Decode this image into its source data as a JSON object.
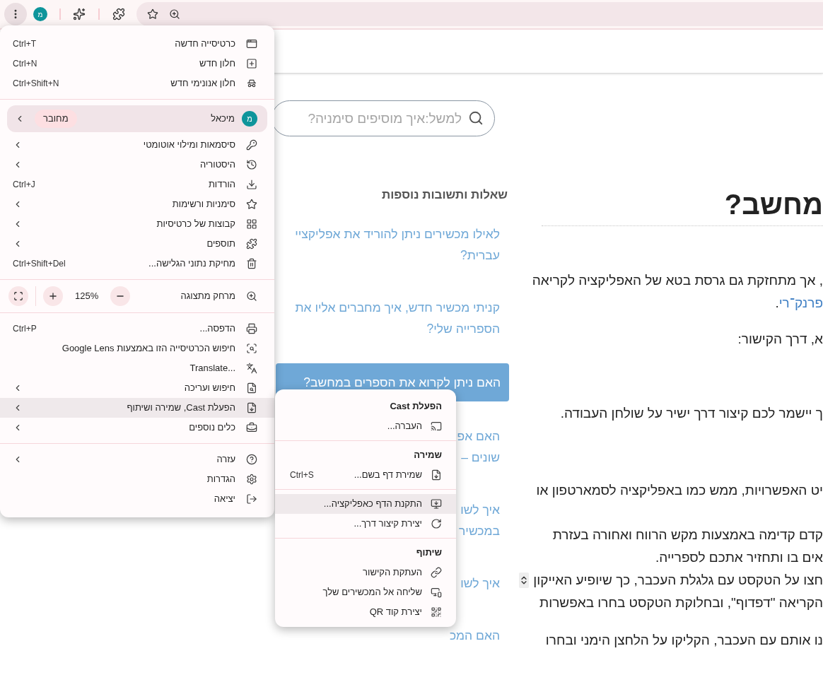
{
  "toolbar": {
    "avatar": "מ"
  },
  "page": {
    "search": {
      "placeholder": "למשל:איך מוסיפים סימניה?"
    },
    "sidebar": {
      "heading": "שאלות ותשובות נוספות",
      "items": [
        {
          "lines": [
            "לאילו מכשירים ניתן להוריד את אפליקציי",
            "עברית?"
          ],
          "selected": false
        },
        {
          "lines": [
            "קניתי מכשיר חדש, איך מחברים אליו את",
            "הספרייה שלי?"
          ],
          "selected": false
        },
        {
          "lines": [
            "האם ניתן לקרוא את הספרים במחשב?"
          ],
          "selected": true
        },
        {
          "lines": [
            "האם אפ",
            "שונים –"
          ],
          "selected": false
        },
        {
          "lines": [
            "איך לשו",
            "במכשיר"
          ],
          "selected": false
        },
        {
          "lines": [
            "איך לשו"
          ],
          "selected": false
        },
        {
          "lines": [
            "האם המכ"
          ],
          "selected": false
        }
      ]
    },
    "article": {
      "title": "מחשב?",
      "paragraphs": [
        {
          "lines": [
            [
              {
                "kind": "text",
                "text": ", אך מתחזקת גם גרסת בטא של האפליקציה לקריאה"
              }
            ],
            [
              {
                "kind": "link",
                "text": "פרנק־רי"
              },
              {
                "kind": "text",
                "text": "."
              }
            ]
          ]
        },
        {
          "lines": [
            [
              {
                "kind": "text",
                "text": "א, דרך הקישור:"
              }
            ]
          ]
        },
        {
          "lines": [
            [
              {
                "kind": "text",
                "text": "ך יישמר לכם קיצור דרך ישיר על שולחן העבודה."
              }
            ]
          ]
        },
        {
          "lines": [
            [
              {
                "kind": "text",
                "text": "יט האפשרויות, ממש כמו באפליקציה לסמארטפון או"
              }
            ]
          ]
        },
        {
          "lines": [
            [
              {
                "kind": "text",
                "text": "קדם קדימה באמצעות מקש הרווח ואחורה בעזרת"
              }
            ],
            [
              {
                "kind": "text",
                "text": "אים בו ותחזיר אתכם לספרייה."
              }
            ],
            [
              {
                "kind": "text",
                "text": "חצו על הטקסט עם גלגלת העכבר, כך שיופיע האייקון"
              },
              {
                "kind": "icon"
              }
            ],
            [
              {
                "kind": "text",
                "text": "הקריאה \"דפדוף\", ובחלוקת הטקסט בחרו באפשרות"
              }
            ]
          ]
        },
        {
          "lines": [
            [
              {
                "kind": "text",
                "text": "נו אותם עם העכבר, הקליקו על הלחצן הימני ובחרו"
              }
            ]
          ]
        }
      ]
    }
  },
  "menu": {
    "sections": [
      {
        "items": [
          {
            "kind": "item",
            "label": "כרטיסייה חדשה",
            "shortcut": "Ctrl+T",
            "submenu": false,
            "highlighted": false
          },
          {
            "kind": "item",
            "label": "חלון חדש",
            "shortcut": "Ctrl+N",
            "submenu": false,
            "highlighted": false
          },
          {
            "kind": "item",
            "label": "חלון אנונימי חדש",
            "shortcut": "Ctrl+Shift+N",
            "submenu": false,
            "highlighted": false
          }
        ]
      },
      {
        "items": [
          {
            "kind": "profile",
            "avatar": "מ",
            "label": "מיכאל",
            "badge": "מחובר",
            "submenu": true
          },
          {
            "kind": "item",
            "label": "סיסמאות ומילוי אוטומטי",
            "submenu": true,
            "highlighted": false
          },
          {
            "kind": "item",
            "label": "היסטוריה",
            "submenu": true,
            "highlighted": false
          },
          {
            "kind": "item",
            "label": "הורדות",
            "shortcut": "Ctrl+J",
            "submenu": false,
            "highlighted": false
          },
          {
            "kind": "item",
            "label": "סימניות ורשימות",
            "submenu": true,
            "highlighted": false
          },
          {
            "kind": "item",
            "label": "קבוצות של כרטיסיות",
            "submenu": true,
            "highlighted": false
          },
          {
            "kind": "item",
            "label": "תוספים",
            "submenu": true,
            "highlighted": false
          },
          {
            "kind": "item",
            "label": "מחיקת נתוני הגלישה...",
            "shortcut": "Ctrl+Shift+Del",
            "submenu": false,
            "highlighted": false
          }
        ]
      },
      {
        "items": [
          {
            "kind": "zoom",
            "label": "מרחק מתצוגה",
            "value": "125%"
          }
        ]
      },
      {
        "items": [
          {
            "kind": "item",
            "label": "הדפסה...",
            "shortcut": "Ctrl+P",
            "submenu": false,
            "highlighted": false
          },
          {
            "kind": "item",
            "label": "חיפוש הכרטיסייה הזו באמצעות Google Lens",
            "submenu": false,
            "highlighted": false
          },
          {
            "kind": "item",
            "label": "Translate...",
            "submenu": false,
            "highlighted": false
          },
          {
            "kind": "item",
            "label": "חיפוש ועריכה",
            "submenu": true,
            "highlighted": false
          },
          {
            "kind": "item",
            "label": "הפעלת Cast, שמירה ושיתוף",
            "submenu": true,
            "highlighted": true
          },
          {
            "kind": "item",
            "label": "כלים נוספים",
            "submenu": true,
            "highlighted": false
          }
        ]
      },
      {
        "items": [
          {
            "kind": "item",
            "label": "עזרה",
            "submenu": true,
            "highlighted": false
          },
          {
            "kind": "item",
            "label": "הגדרות",
            "submenu": false,
            "highlighted": false
          },
          {
            "kind": "item",
            "label": "יציאה",
            "submenu": false,
            "highlighted": false
          }
        ]
      }
    ]
  },
  "submenu": {
    "sections": [
      {
        "heading": "הפעלת Cast",
        "items": [
          {
            "label": "העברה...",
            "highlighted": false
          }
        ]
      },
      {
        "heading": "שמירה",
        "items": [
          {
            "label": "שמירת דף בשם...",
            "shortcut": "Ctrl+S",
            "highlighted": false
          }
        ]
      },
      {
        "items": [
          {
            "label": "התקנת הדף כאפליקציה...",
            "highlighted": true
          },
          {
            "label": "יצירת קיצור דרך...",
            "highlighted": false
          }
        ]
      },
      {
        "heading": "שיתוף",
        "items": [
          {
            "label": "העתקת הקישור",
            "highlighted": false
          },
          {
            "label": "שליחה אל המכשירים שלך",
            "highlighted": false
          },
          {
            "label": "יצירת קוד QR",
            "highlighted": false
          }
        ]
      }
    ]
  }
}
